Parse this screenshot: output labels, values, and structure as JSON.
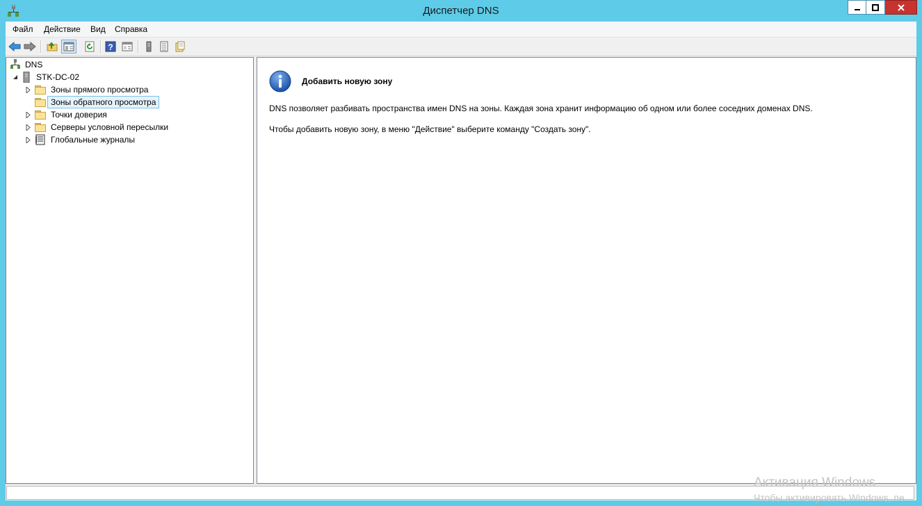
{
  "window": {
    "title": "Диспетчер DNS"
  },
  "menu": [
    "Файл",
    "Действие",
    "Вид",
    "Справка"
  ],
  "toolbar": [
    {
      "icon": "back-arrow-icon"
    },
    {
      "icon": "forward-arrow-icon"
    },
    {
      "icon": "up-folder-icon"
    },
    {
      "icon": "show-hide-tree-icon",
      "pressed": true
    },
    {
      "icon": "refresh-icon"
    },
    {
      "icon": "help-icon"
    },
    {
      "icon": "properties-icon"
    },
    {
      "icon": "server-icon"
    },
    {
      "icon": "list-icon"
    },
    {
      "icon": "records-icon"
    }
  ],
  "tree": {
    "root": "DNS",
    "server": "STK-DC-02",
    "items": [
      {
        "label": "Зоны прямого просмотра",
        "expandable": true,
        "selected": false
      },
      {
        "label": "Зоны обратного просмотра",
        "expandable": false,
        "selected": true
      },
      {
        "label": "Точки доверия",
        "expandable": true,
        "selected": false
      },
      {
        "label": "Серверы условной пересылки",
        "expandable": true,
        "selected": false
      },
      {
        "label": "Глобальные журналы",
        "expandable": true,
        "selected": false
      }
    ]
  },
  "detail": {
    "title": "Добавить новую зону",
    "text1": "DNS позволяет разбивать пространства имен DNS на зоны. Каждая зона хранит информацию об одном или более соседних доменах DNS.",
    "text2": "Чтобы добавить новую зону, в меню \"Действие\" выберите команду \"Создать зону\"."
  },
  "watermark": {
    "line1": "Активация Windows",
    "line2": "Чтобы активировать Windows, пе"
  },
  "colors": {
    "titlebar": "#5ecbe8",
    "close": "#c7332e",
    "selection": "#e5f3fb"
  }
}
